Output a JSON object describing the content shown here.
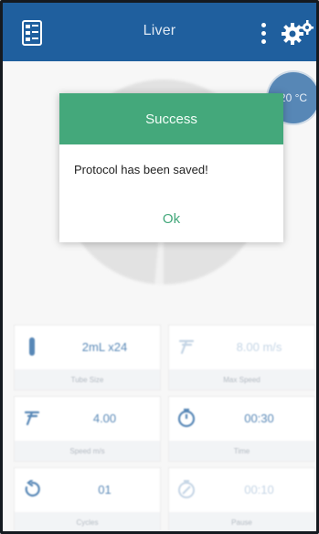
{
  "header": {
    "title": "Liver"
  },
  "temperature": "20 °C",
  "dialog": {
    "title": "Success",
    "message": "Protocol has been saved!",
    "ok_label": "Ok"
  },
  "tiles": [
    {
      "value": "2mL x24",
      "label": "Tube Size",
      "icon": "test-tube-icon",
      "enabled": true
    },
    {
      "value": "8.00 m/s",
      "label": "Max Speed",
      "icon": "speed-icon",
      "enabled": false
    },
    {
      "value": "4.00",
      "label": "Speed m/s",
      "icon": "speed-icon",
      "enabled": true
    },
    {
      "value": "00:30",
      "label": "Time",
      "icon": "stopwatch-icon",
      "enabled": true
    },
    {
      "value": "01",
      "label": "Cycles",
      "icon": "repeat-icon",
      "enabled": true
    },
    {
      "value": "00:10",
      "label": "Pause",
      "icon": "pause-timer-icon",
      "enabled": false
    }
  ],
  "colors": {
    "primary": "#1f5f9e",
    "success": "#44a87b"
  }
}
